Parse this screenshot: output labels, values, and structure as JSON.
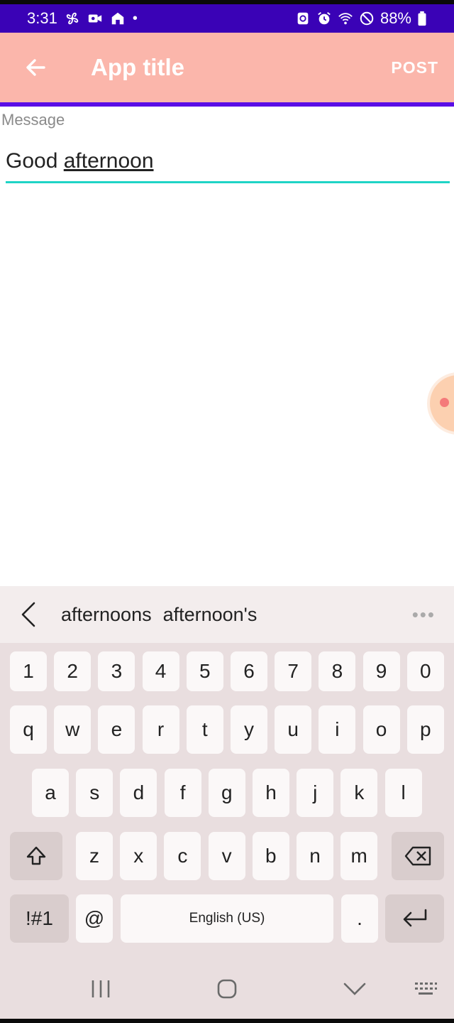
{
  "status_bar": {
    "time": "3:31",
    "battery": "88%",
    "dot": "•",
    "left_icons": [
      "fan-icon",
      "video-icon",
      "home-icon"
    ],
    "right_icons": [
      "sync-icon",
      "alarm-icon",
      "wifi-icon",
      "do-not-disturb-icon",
      "battery-icon"
    ]
  },
  "app_bar": {
    "title": "App title",
    "action": "POST",
    "back_icon": "arrow-left-icon"
  },
  "message_field": {
    "label": "Message",
    "value_plain": "Good ",
    "value_composing": "afternoon"
  },
  "keyboard": {
    "suggestions": [
      "afternoons",
      "afternoon's"
    ],
    "more": "•••",
    "row_numbers": [
      "1",
      "2",
      "3",
      "4",
      "5",
      "6",
      "7",
      "8",
      "9",
      "0"
    ],
    "row_q": [
      "q",
      "w",
      "e",
      "r",
      "t",
      "y",
      "u",
      "i",
      "o",
      "p"
    ],
    "row_a": [
      "a",
      "s",
      "d",
      "f",
      "g",
      "h",
      "j",
      "k",
      "l"
    ],
    "row_z": [
      "z",
      "x",
      "c",
      "v",
      "b",
      "n",
      "m"
    ],
    "symbols_key": "!#1",
    "at_key": "@",
    "space_key": "English (US)",
    "period_key": "."
  },
  "colors": {
    "status_bar": "#3a02b6",
    "app_bar": "#fbb6ab",
    "accent_line": "#5a0ee6",
    "field_underline": "#1fd4c6"
  }
}
